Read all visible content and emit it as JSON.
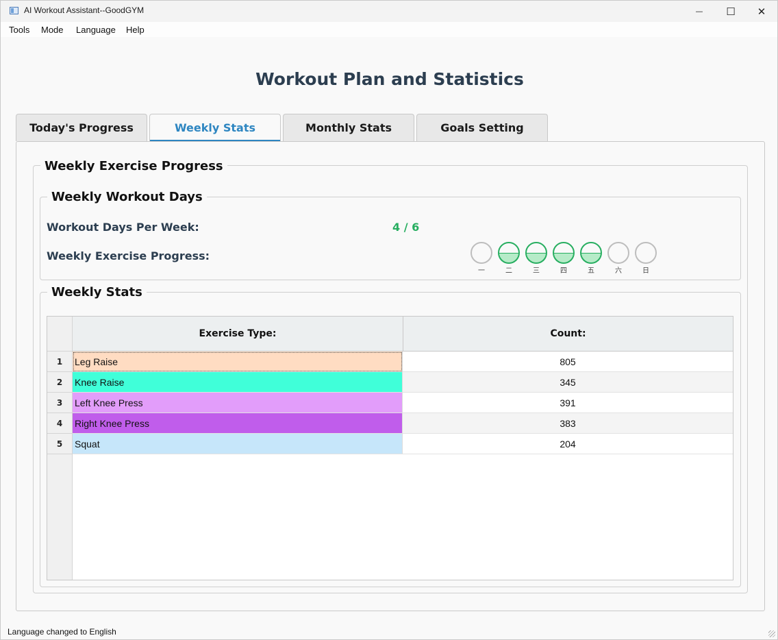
{
  "window": {
    "title": "AI Workout Assistant--GoodGYM",
    "controls": {
      "minimize": "—",
      "maximize": "☐",
      "close": "✕"
    }
  },
  "menu": [
    "Tools",
    "Mode",
    "Language",
    "Help"
  ],
  "page_title": "Workout Plan and Statistics",
  "tabs": [
    {
      "label": "Today's Progress",
      "active": false
    },
    {
      "label": "Weekly Stats",
      "active": true
    },
    {
      "label": "Monthly Stats",
      "active": false
    },
    {
      "label": "Goals Setting",
      "active": false
    }
  ],
  "weekly_progress": {
    "title": "Weekly Exercise Progress",
    "workout_days": {
      "title": "Weekly Workout Days",
      "days_label": "Workout Days Per Week:",
      "days_value": "4 / 6",
      "progress_label": "Weekly Exercise Progress:",
      "days": [
        {
          "label": "一",
          "done": false
        },
        {
          "label": "二",
          "done": true
        },
        {
          "label": "三",
          "done": true
        },
        {
          "label": "四",
          "done": true
        },
        {
          "label": "五",
          "done": true
        },
        {
          "label": "六",
          "done": false
        },
        {
          "label": "日",
          "done": false
        }
      ]
    },
    "stats": {
      "title": "Weekly Stats",
      "headers": {
        "type": "Exercise Type:",
        "count": "Count:"
      },
      "rows": [
        {
          "index": "1",
          "type": "Leg Raise",
          "count": "805",
          "color": "#ffdcc2"
        },
        {
          "index": "2",
          "type": "Knee Raise",
          "count": "345",
          "color": "#40ffd9"
        },
        {
          "index": "3",
          "type": "Left Knee Press",
          "count": "391",
          "color": "#e29dfa"
        },
        {
          "index": "4",
          "type": "Right Knee Press",
          "count": "383",
          "color": "#c05deb"
        },
        {
          "index": "5",
          "type": "Squat",
          "count": "204",
          "color": "#c6e6fa"
        }
      ]
    }
  },
  "status_bar": "Language changed to English",
  "colors": {
    "accent": "#2e86c1",
    "success": "#27ae60",
    "title": "#2c3e50"
  }
}
